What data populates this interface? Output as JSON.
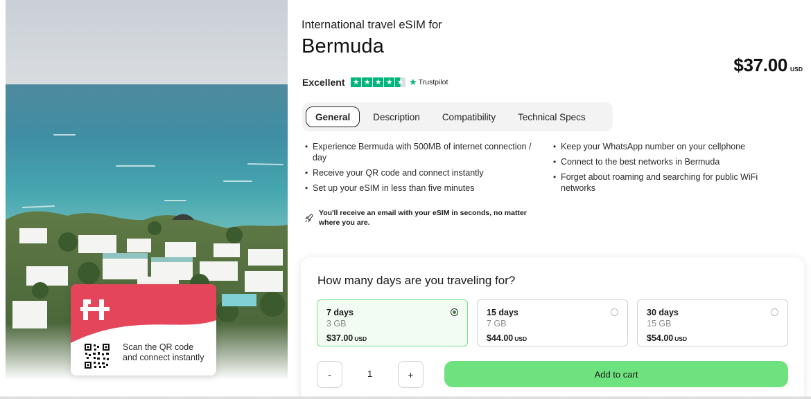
{
  "hero": {
    "card": {
      "logo": "H",
      "caption": "Scan the QR code and connect instantly",
      "icons": [
        "holafly-logo-icon",
        "qr-code-icon"
      ],
      "brand_color": "#e5455a"
    }
  },
  "product": {
    "subtitle": "International travel eSIM for",
    "title": "Bermuda",
    "price": "$37.00",
    "currency": "USD",
    "rating": {
      "label": "Excellent",
      "stars": 4.5,
      "provider": "Trustpilot",
      "color": "#00b67a"
    }
  },
  "tabs": [
    {
      "label": "General",
      "active": true
    },
    {
      "label": "Description",
      "active": false
    },
    {
      "label": "Compatibility",
      "active": false
    },
    {
      "label": "Technical Specs",
      "active": false
    }
  ],
  "features": {
    "left": [
      "Experience Bermuda with 500MB of internet connection / day",
      "Receive your QR code and connect instantly",
      "Set up your eSIM in less than five minutes"
    ],
    "right": [
      "Keep your WhatsApp number on your cellphone",
      "Connect to the best networks in Bermuda",
      "Forget about roaming and searching for public WiFi networks"
    ]
  },
  "note": {
    "icon": "rocket-icon",
    "text": "You'll receive an email with your eSIM in seconds, no matter where you are."
  },
  "plans": {
    "title": "How many days are you traveling for?",
    "options": [
      {
        "days": "7 days",
        "data": "3 GB",
        "price": "$37.00",
        "currency": "USD",
        "selected": true
      },
      {
        "days": "15 days",
        "data": "7 GB",
        "price": "$44.00",
        "currency": "USD",
        "selected": false
      },
      {
        "days": "30 days",
        "data": "15 GB",
        "price": "$54.00",
        "currency": "USD",
        "selected": false
      }
    ]
  },
  "quantity": {
    "minus": "-",
    "value": "1",
    "plus": "+"
  },
  "cart": {
    "label": "Add to cart",
    "color": "#6ee27f"
  }
}
